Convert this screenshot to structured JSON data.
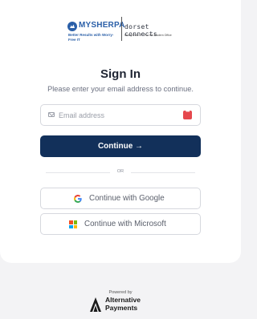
{
  "logos": {
    "mysherpa": {
      "name": "MYSHERPA",
      "tagline": "Better Results with Worry-Free IT"
    },
    "dorset": {
      "name": "dorset connects",
      "tagline": "Worry-Free IT · For the Modern Office"
    }
  },
  "heading": {
    "title": "Sign In",
    "subtitle": "Please enter your email address to continue."
  },
  "email": {
    "placeholder": "Email address",
    "value": ""
  },
  "continue_button": {
    "label": "Continue →"
  },
  "divider": {
    "label": "OR"
  },
  "sso": {
    "google_label": "Continue with Google",
    "microsoft_label": "Continue with Microsoft"
  },
  "footer": {
    "powered_by": "Powered by",
    "brand_line1": "Alternative",
    "brand_line2": "Payments"
  },
  "colors": {
    "primary": "#12305a",
    "google_blue": "#4285F4",
    "google_red": "#EA4335",
    "google_yellow": "#FBBC05",
    "google_green": "#34A853",
    "ms_red": "#F25022",
    "ms_green": "#7FBA00",
    "ms_blue": "#00A4EF",
    "ms_yellow": "#FFB900"
  }
}
